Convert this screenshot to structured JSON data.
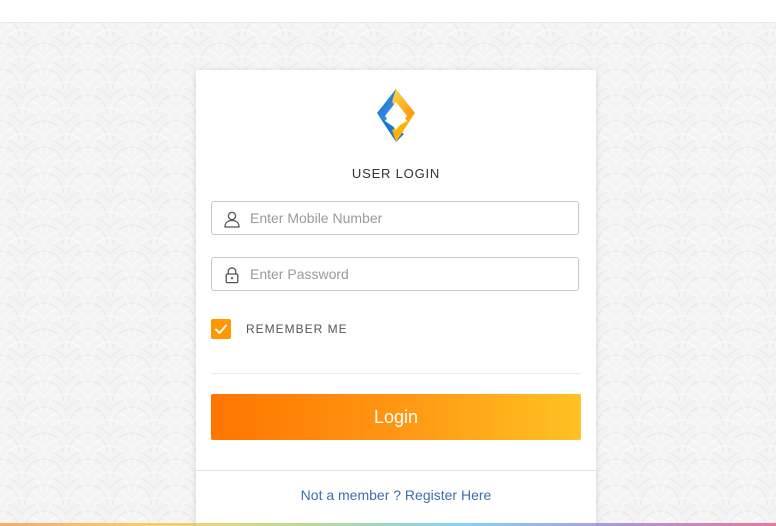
{
  "login_card": {
    "title": "USER LOGIN",
    "mobile_field": {
      "value": "",
      "placeholder": "Enter Mobile Number",
      "icon": "user-icon"
    },
    "password_field": {
      "value": "",
      "placeholder": "Enter Password",
      "icon": "lock-icon"
    },
    "remember_me": {
      "label": "REMEMBER ME",
      "checked": true
    },
    "login_button_label": "Login",
    "register_link_text": "Not a member ? Register Here"
  },
  "colors": {
    "accent_orange": "#ff9800",
    "button_gradient_start": "#ff7500",
    "button_gradient_end": "#ffc224",
    "link_blue": "#3b6fae",
    "logo_blue": "#1e88e5",
    "logo_yellow": "#ffb300"
  }
}
